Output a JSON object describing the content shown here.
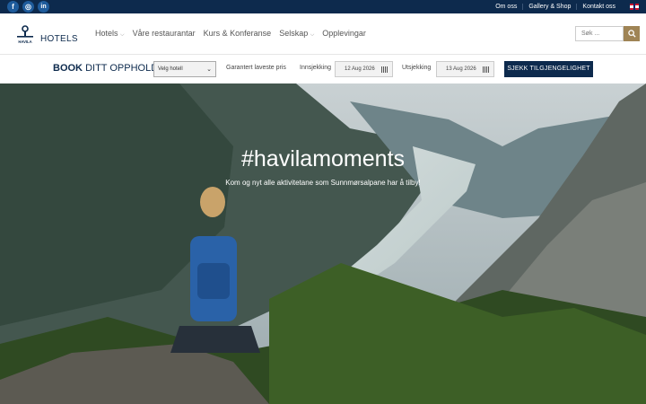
{
  "topbar": {
    "links": [
      "Om oss",
      "Gallery & Shop",
      "Kontakt oss"
    ],
    "social": [
      {
        "icon": "facebook-icon",
        "glyph": "f"
      },
      {
        "icon": "instagram-icon",
        "glyph": "◎"
      },
      {
        "icon": "linkedin-icon",
        "glyph": "in"
      }
    ]
  },
  "header": {
    "brand": "HOTELS",
    "logo_text": "HAVILA",
    "nav": [
      {
        "label": "Hotels",
        "dropdown": true
      },
      {
        "label": "Våre restaurantar",
        "dropdown": false
      },
      {
        "label": "Kurs & Konferanse",
        "dropdown": false
      },
      {
        "label": "Selskap",
        "dropdown": true
      },
      {
        "label": "Opplevingar",
        "dropdown": false
      }
    ],
    "search_placeholder": "Søk ..."
  },
  "booking": {
    "title_bold": "BOOK",
    "title_rest": "DITT OPPHOLD",
    "hotel_select": "Velg hotell",
    "guarantee": "Garantert laveste pris",
    "checkin_label": "Innsjekking",
    "checkin_value": "12 Aug 2026",
    "checkout_label": "Utsjekking",
    "checkout_value": "13 Aug 2026",
    "check_button": "SJEKK TILGJENGELIGHET"
  },
  "hero": {
    "title": "#havilamoments",
    "subtitle": "Kom og nyt alle aktivitetane som Sunnmørsalpane har å tilby!"
  },
  "colors": {
    "navy": "#0d2a4d",
    "gold": "#9f8455"
  }
}
